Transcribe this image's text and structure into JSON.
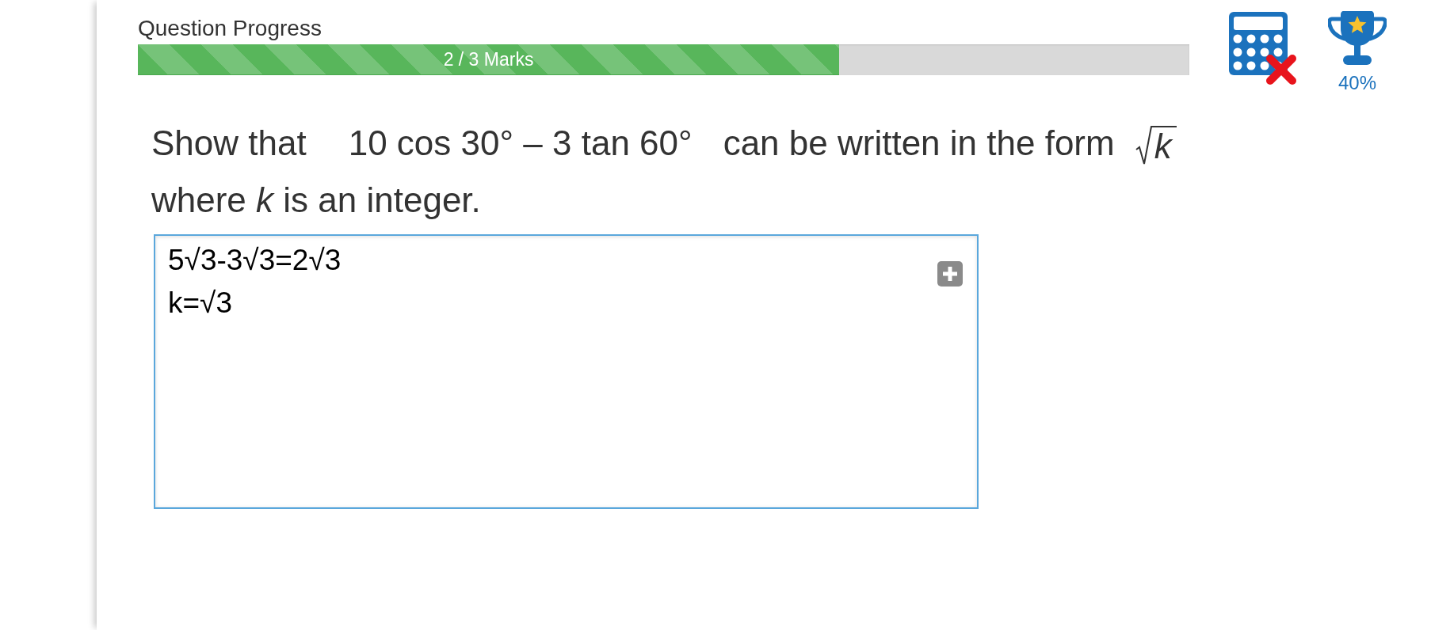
{
  "progress": {
    "label": "Question Progress",
    "level": 0.667,
    "reading": "2 / 3 Marks"
  },
  "tools": {
    "calculator": {
      "allowed": false
    },
    "trophy": {
      "score": "40%"
    }
  },
  "question": {
    "line_1": [
      {
        "kind": "text",
        "text": "Show that"
      },
      {
        "kind": "math",
        "text": "10 cos 30° – 3 tan 60°"
      },
      {
        "kind": "text",
        "text": "can be written in the form"
      },
      {
        "kind": "sqrt",
        "text": "k"
      }
    ],
    "line_2": "where *k* is an integer."
  },
  "answer": {
    "lines": [
      "5√3-3√3=2√3",
      "k=√3"
    ]
  }
}
